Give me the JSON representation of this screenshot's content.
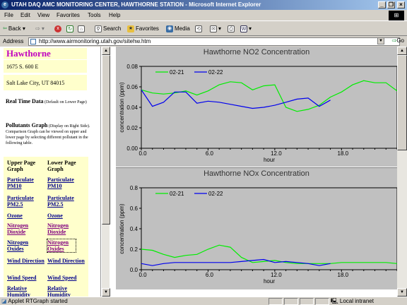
{
  "window": {
    "title": "UTAH DAQ AMC MONITORING CENTER, HAWTHORNE STATION - Microsoft Internet Explorer",
    "controls": {
      "minimize": "_",
      "maximize": "❐",
      "close": "×"
    }
  },
  "menu": [
    "File",
    "Edit",
    "View",
    "Favorites",
    "Tools",
    "Help"
  ],
  "toolbar": {
    "back": "Back",
    "search": "Search",
    "favorites": "Favorites",
    "media": "Media"
  },
  "address": {
    "label": "Address",
    "url": "http://www.airmonitoring.utah.gov/sitehw.htm",
    "go": "Go"
  },
  "sidebar": {
    "station": "Hawthorne",
    "street": "1675 S. 600 E",
    "city": "Salt Lake City, UT 84015",
    "realtime_title": "Real Time Data",
    "realtime_note": "(Default on Lower Page)",
    "pollutants_title": "Pollutants Graph",
    "pollutants_note": "(Display on Right Side). Comparison Graph can be viewed on upper and lower page by selecting different pollutant in the following table.",
    "col_upper": "Upper Page Graph",
    "col_lower": "Lower Page Graph",
    "rows": [
      [
        "Particulate PM10",
        "Particulate PM10"
      ],
      [
        "Particulate PM2.5",
        "Particulate PM2.5"
      ],
      [
        "Ozone",
        "Ozone"
      ],
      [
        "Nitrogen Dioxide",
        "Nitrogen Dioxide"
      ],
      [
        "Nitrogen Oxides",
        "Nitrogen Oxides"
      ],
      [
        "Wind Direction",
        "Wind Direction"
      ],
      [
        "Wind Speed",
        "Wind Speed"
      ],
      [
        "Relative Humidity",
        "Relative Humidity"
      ]
    ]
  },
  "chart_data": [
    {
      "type": "line",
      "title": "Hawthorne NO2 Concentration",
      "xlabel": "hour",
      "ylabel": "concentration (ppm)",
      "xlim": [
        0,
        23
      ],
      "ylim": [
        0,
        0.08
      ],
      "xticks": [
        "0.0",
        "6.0",
        "12.0",
        "18.0"
      ],
      "yticks": [
        "0.00",
        "0.02",
        "0.04",
        "0.06",
        "0.08"
      ],
      "series": [
        {
          "name": "02-21",
          "color": "#00ee00",
          "x": [
            0,
            1,
            2,
            3,
            4,
            5,
            6,
            7,
            8,
            9,
            10,
            11,
            12,
            13,
            14,
            15,
            16,
            17,
            18,
            19,
            20,
            21,
            22,
            23
          ],
          "y": [
            0.057,
            0.054,
            0.053,
            0.054,
            0.056,
            0.052,
            0.056,
            0.062,
            0.065,
            0.064,
            0.057,
            0.061,
            0.062,
            0.04,
            0.036,
            0.038,
            0.042,
            0.05,
            0.055,
            0.062,
            0.066,
            0.064,
            0.064,
            0.056
          ]
        },
        {
          "name": "02-22",
          "color": "#0000ee",
          "x": [
            0,
            1,
            2,
            3,
            4,
            5,
            6,
            7,
            8,
            9,
            10,
            11,
            12,
            13,
            14,
            15,
            16,
            17
          ],
          "y": [
            0.057,
            0.041,
            0.045,
            0.055,
            0.055,
            0.044,
            0.046,
            0.045,
            0.043,
            0.041,
            0.039,
            0.04,
            0.042,
            0.045,
            0.048,
            0.049,
            0.041,
            0.047
          ]
        }
      ]
    },
    {
      "type": "line",
      "title": "Hawthorne NOx Concentration",
      "xlabel": "hour",
      "ylabel": "concentration (ppm)",
      "xlim": [
        0,
        23
      ],
      "ylim": [
        0,
        0.8
      ],
      "xticks": [
        "0.0",
        "6.0",
        "12.0",
        "18.0"
      ],
      "yticks": [
        "0.0",
        "0.2",
        "0.4",
        "0.6",
        "0.8"
      ],
      "series": [
        {
          "name": "02-21",
          "color": "#00ee00",
          "x": [
            0,
            1,
            2,
            3,
            4,
            5,
            6,
            7,
            8,
            9,
            10,
            11,
            12,
            13,
            14,
            15,
            16,
            17,
            18,
            19,
            20,
            21,
            22,
            23
          ],
          "y": [
            0.2,
            0.19,
            0.15,
            0.12,
            0.14,
            0.15,
            0.2,
            0.24,
            0.22,
            0.12,
            0.07,
            0.08,
            0.09,
            0.07,
            0.06,
            0.06,
            0.06,
            0.06,
            0.07,
            0.07,
            0.07,
            0.07,
            0.07,
            0.06
          ]
        },
        {
          "name": "02-22",
          "color": "#0000ee",
          "x": [
            0,
            1,
            2,
            3,
            4,
            5,
            6,
            7,
            8,
            9,
            10,
            11,
            12,
            13,
            14,
            15,
            16,
            17
          ],
          "y": [
            0.06,
            0.04,
            0.06,
            0.07,
            0.07,
            0.07,
            0.07,
            0.07,
            0.07,
            0.08,
            0.09,
            0.1,
            0.07,
            0.08,
            0.07,
            0.06,
            0.04,
            0.06
          ]
        }
      ]
    }
  ],
  "status": {
    "text": "Applet RTGraph started",
    "zone": "Local intranet"
  },
  "colors": {
    "title_gradient_start": "#0a246a",
    "station_name": "#c000c0",
    "link": "#00008b",
    "visited": "#800080",
    "sidebar_bg": "#ffffcc",
    "applet_bg": "#c0c0c0"
  }
}
